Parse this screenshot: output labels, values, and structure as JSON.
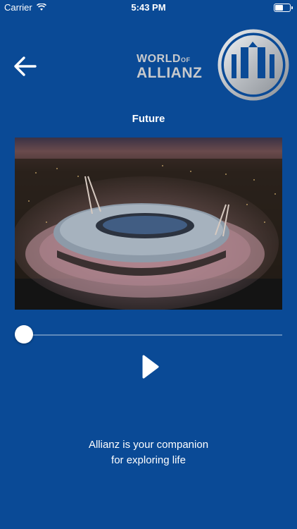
{
  "status_bar": {
    "carrier": "Carrier",
    "time": "5:43 PM"
  },
  "header": {
    "back_icon": "arrow-left-icon",
    "brand_world": "WORLD",
    "brand_of": "OF",
    "brand_allianz": "ALLIANZ",
    "logo_icon": "allianz-logo-icon"
  },
  "title": "Future",
  "video": {
    "image": "aerial stadium at dusk"
  },
  "player": {
    "progress": 0.0,
    "play_icon": "play-icon"
  },
  "tagline": {
    "line1": "Allianz is your companion",
    "line2": "for exploring life"
  },
  "colors": {
    "background": "#0a4a96",
    "accent": "#ffffff",
    "logo_silver": "#c7c9cc"
  }
}
